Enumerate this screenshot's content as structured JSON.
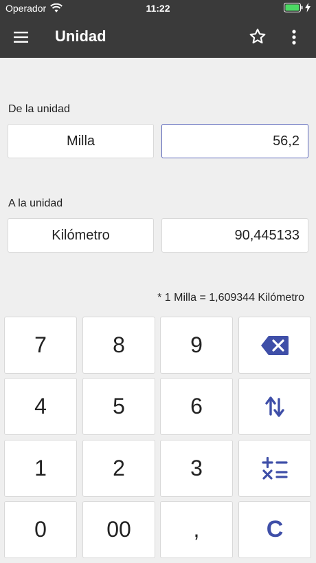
{
  "status": {
    "carrier": "Operador",
    "time": "11:22"
  },
  "appbar": {
    "title": "Unidad"
  },
  "from": {
    "label": "De la unidad",
    "unit": "Milla",
    "value": "56,2"
  },
  "to": {
    "label": "A la unidad",
    "unit": "Kilómetro",
    "value": "90,445133"
  },
  "conversion_note": "* 1 Milla = 1,609344 Kilómetro",
  "keypad": {
    "k7": "7",
    "k8": "8",
    "k9": "9",
    "k4": "4",
    "k5": "5",
    "k6": "6",
    "k1": "1",
    "k2": "2",
    "k3": "3",
    "k0": "0",
    "k00": "00",
    "comma": ",",
    "clear": "C"
  },
  "colors": {
    "accent": "#3f4fa8",
    "appbar": "#3a3a3a",
    "background": "#efefef"
  }
}
